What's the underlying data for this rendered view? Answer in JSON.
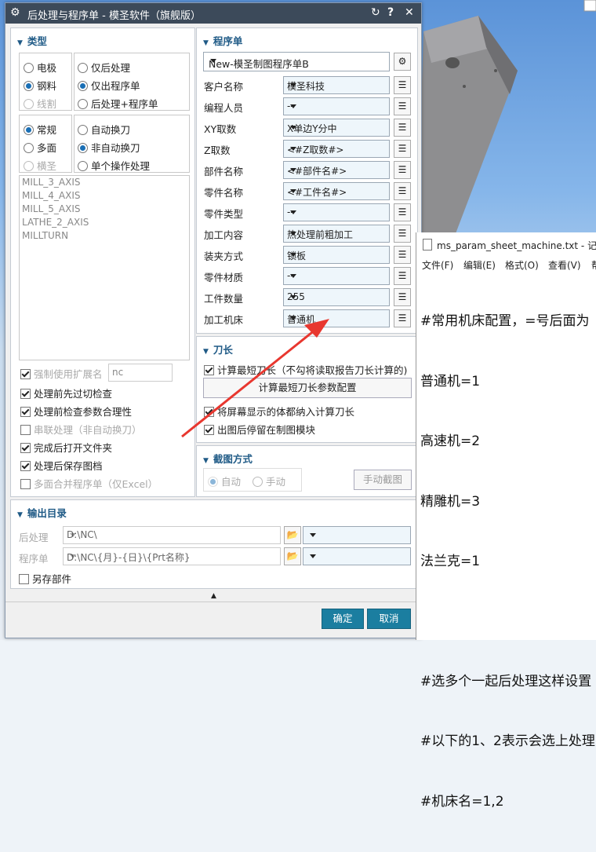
{
  "dialog": {
    "title": "后处理与程序单 - 模圣软件（旗舰版）"
  },
  "type_section": {
    "title": "类型",
    "machine": [
      "电极",
      "钢料",
      "线割"
    ],
    "process": [
      "仅后处理",
      "仅出程序单",
      "后处理+程序单"
    ],
    "mode": [
      "常规",
      "多面",
      "横圣"
    ],
    "change": [
      "自动换刀",
      "非自动换刀",
      "单个操作处理"
    ],
    "list": [
      "MILL_3_AXIS",
      "MILL_4_AXIS",
      "MILL_5_AXIS",
      "LATHE_2_AXIS",
      "MILLTURN"
    ],
    "ext_label": "强制使用扩展名",
    "ext_value": "nc",
    "options": [
      "处理前先过切检查",
      "处理前检查参数合理性",
      "串联处理（非自动换刀）",
      "完成后打开文件夹",
      "处理后保存图档",
      "多面合并程序单（仅Excel）"
    ]
  },
  "program_section": {
    "title": "程序单",
    "template": "New-模圣制图程序单B",
    "rows": [
      {
        "label": "客户名称",
        "value": "模圣科技"
      },
      {
        "label": "编程人员",
        "value": "--"
      },
      {
        "label": "XY取数",
        "value": "X单边Y分中"
      },
      {
        "label": "Z取数",
        "value": "<#Z取数#>"
      },
      {
        "label": "部件名称",
        "value": "<#部件名#>"
      },
      {
        "label": "零件名称",
        "value": "<#工件名#>"
      },
      {
        "label": "零件类型",
        "value": "--"
      },
      {
        "label": "加工内容",
        "value": "热处理前粗加工"
      },
      {
        "label": "装夹方式",
        "value": "锁板"
      },
      {
        "label": "零件材质",
        "value": "--"
      },
      {
        "label": "工件数量",
        "value": "255"
      },
      {
        "label": "加工机床",
        "value": "普通机"
      }
    ]
  },
  "tool_section": {
    "title": "刀长",
    "calc_label": "计算最短刀长（不勾将读取报告刀长计算的)",
    "config_button": "计算最短刀长参数配置",
    "include_label": "将屏幕显示的体都纳入计算刀长",
    "stay_label": "出图后停留在制图模块"
  },
  "capture_section": {
    "title": "截图方式",
    "auto": "自动",
    "manual": "手动",
    "manual_btn": "手动截图"
  },
  "output_section": {
    "title": "输出目录",
    "post_label": "后处理",
    "post_path": "D:\\NC\\",
    "sheet_label": "程序单",
    "sheet_path": "D:\\NC\\{月}-{日}\\{Prt名称}",
    "save_label": "另存部件"
  },
  "buttons": {
    "ok": "确定",
    "cancel": "取消"
  },
  "notepad": {
    "title": "ms_param_sheet_machine.txt - 记事",
    "menu": [
      "文件(F)",
      "编辑(E)",
      "格式(O)",
      "查看(V)",
      "帮"
    ],
    "lines": [
      "#常用机床配置，=号后面为",
      "普通机=1",
      "高速机=2",
      "精雕机=3",
      "法兰克=1",
      "",
      "#选多个一起后处理这样设置",
      "#以下的1、2表示会选上处理",
      "#机床名=1,2"
    ]
  },
  "colors": {
    "accent": "#1b7ea0",
    "arrow": "#e8372f",
    "title_bar": "#3c4a5a"
  }
}
